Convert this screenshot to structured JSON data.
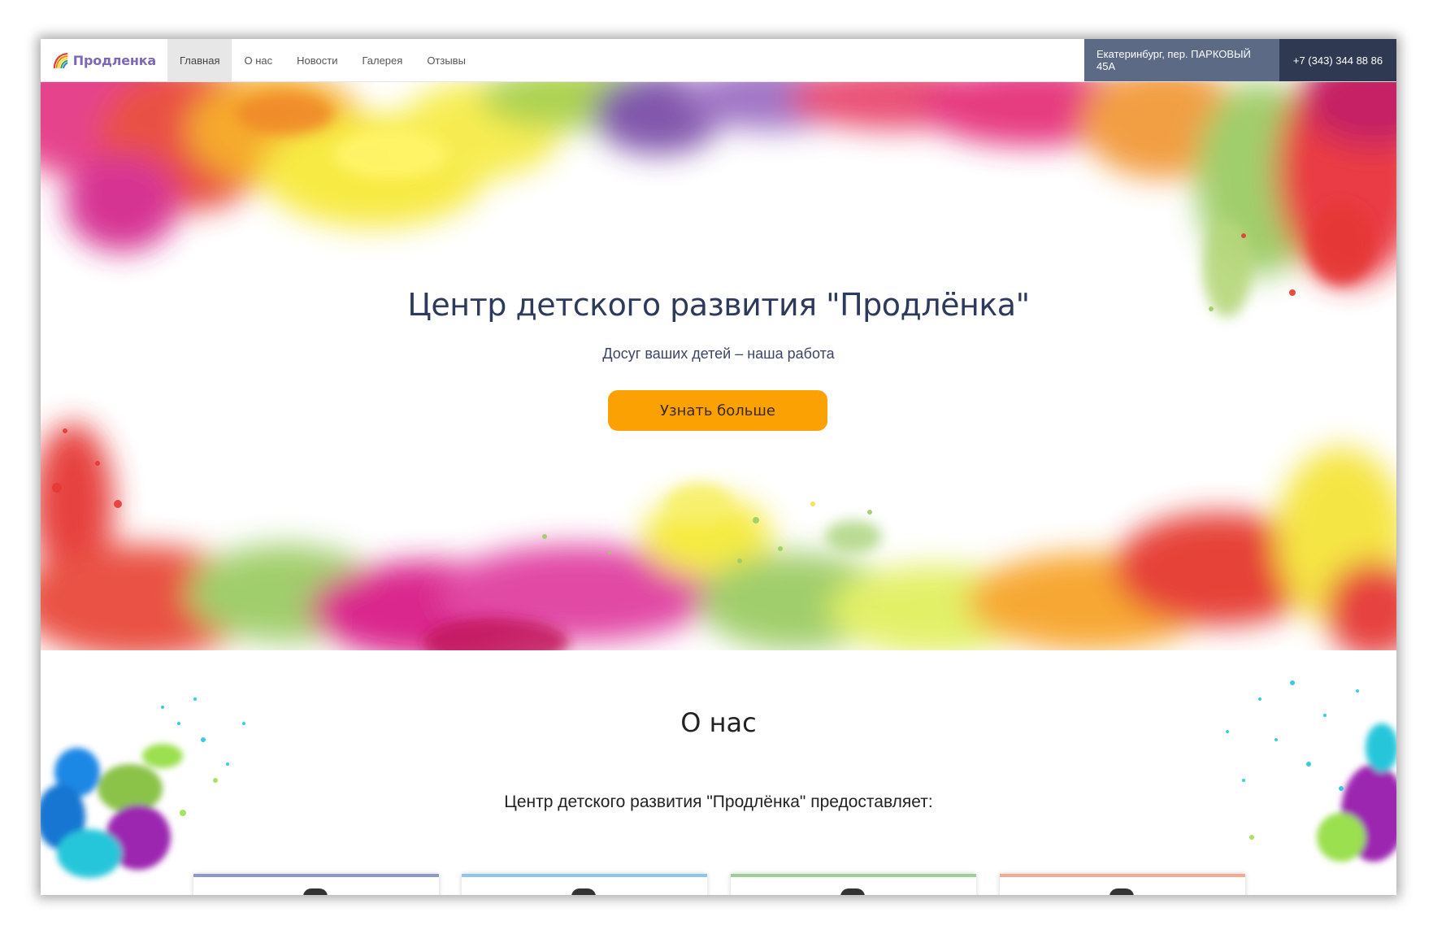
{
  "brand": {
    "name": "Продленка"
  },
  "nav": {
    "items": [
      {
        "label": "Главная",
        "active": true
      },
      {
        "label": "О нас",
        "active": false
      },
      {
        "label": "Новости",
        "active": false
      },
      {
        "label": "Галерея",
        "active": false
      },
      {
        "label": "Отзывы",
        "active": false
      }
    ],
    "address": "Екатеринбург, пер. ПАРКОВЫЙ 45А",
    "phone": "+7 (343) 344 88 86"
  },
  "hero": {
    "title": "Центр детского развития \"Продлёнка\"",
    "subtitle": "Досуг ваших детей – наша работа",
    "button_label": "Узнать больше"
  },
  "about": {
    "title": "О нас",
    "lead": "Центр детского развития \"Продлёнка\" предоставляет:",
    "cards": [
      {
        "accent": "#8e96cc"
      },
      {
        "accent": "#8ec7ea"
      },
      {
        "accent": "#9ecf98"
      },
      {
        "accent": "#f7a98f"
      }
    ]
  },
  "colors": {
    "button": "#fba103",
    "address_bg": "#5d6a86",
    "phone_bg": "#2f3a52",
    "title": "#2e3a5c"
  }
}
